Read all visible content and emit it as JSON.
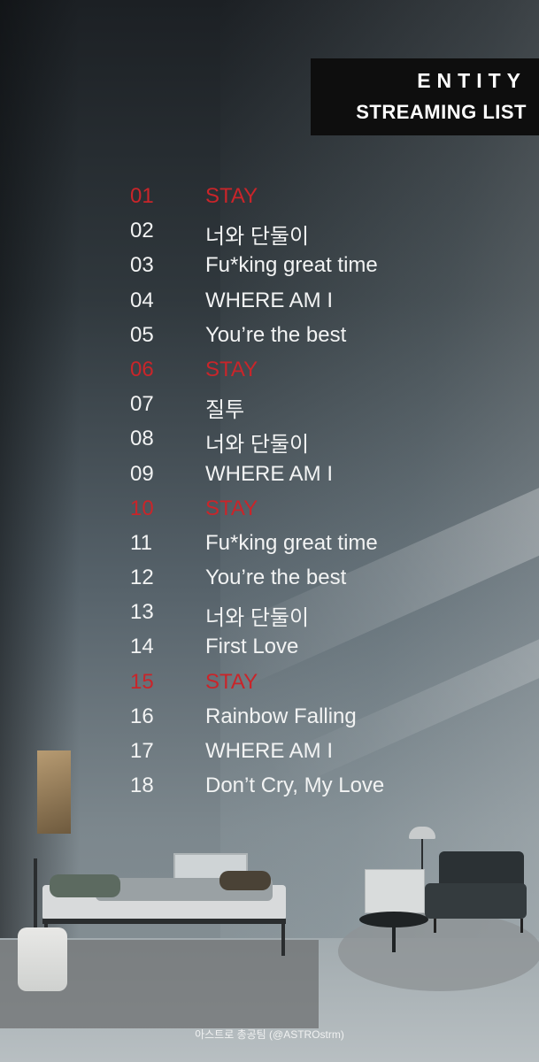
{
  "header": {
    "line1": "ENTITY",
    "line2": "STREAMING LIST"
  },
  "accent_color": "#c9252a",
  "tracks": [
    {
      "num": "01",
      "title": "STAY",
      "highlight": true
    },
    {
      "num": "02",
      "title": "너와 단둘이",
      "highlight": false
    },
    {
      "num": "03",
      "title": "Fu*king great time",
      "highlight": false
    },
    {
      "num": "04",
      "title": "WHERE AM I",
      "highlight": false
    },
    {
      "num": "05",
      "title": "You’re the best",
      "highlight": false
    },
    {
      "num": "06",
      "title": "STAY",
      "highlight": true
    },
    {
      "num": "07",
      "title": "질투",
      "highlight": false
    },
    {
      "num": "08",
      "title": "너와 단둘이",
      "highlight": false
    },
    {
      "num": "09",
      "title": "WHERE AM I",
      "highlight": false
    },
    {
      "num": "10",
      "title": "STAY",
      "highlight": true
    },
    {
      "num": "11",
      "title": "Fu*king great time",
      "highlight": false
    },
    {
      "num": "12",
      "title": "You’re the best",
      "highlight": false
    },
    {
      "num": "13",
      "title": "너와 단둘이",
      "highlight": false
    },
    {
      "num": "14",
      "title": "First Love",
      "highlight": false
    },
    {
      "num": "15",
      "title": "STAY",
      "highlight": true
    },
    {
      "num": "16",
      "title": "Rainbow Falling",
      "highlight": false
    },
    {
      "num": "17",
      "title": "WHERE AM I",
      "highlight": false
    },
    {
      "num": "18",
      "title": "Don’t Cry, My Love",
      "highlight": false
    }
  ],
  "footer": {
    "credit": "아스트로 총공팀 (@ASTROstrm)"
  }
}
